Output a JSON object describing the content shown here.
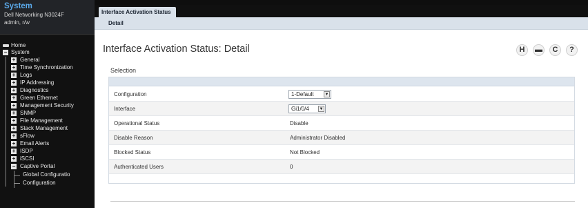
{
  "system_panel": {
    "title": "System",
    "device": "Dell Networking N3024F",
    "user": "admin, r/w"
  },
  "nav": {
    "home": "Home",
    "system": "System",
    "items": [
      "General",
      "Time Synchronization",
      "Logs",
      "IP Addressing",
      "Diagnostics",
      "Green Ethernet",
      "Management Security",
      "SNMP",
      "File Management",
      "Stack Management",
      "sFlow",
      "Email Alerts",
      "ISDP",
      "iSCSI",
      "Captive Portal"
    ],
    "captive_children": [
      "Global Configuratio",
      "Configuration"
    ]
  },
  "tabs": {
    "active": "Interface Activation Status",
    "sub": "Detail"
  },
  "page": {
    "title": "Interface Activation Status: Detail",
    "section": "Selection"
  },
  "toolbar": {
    "save": "H",
    "print": "▬",
    "refresh": "C",
    "help": "?"
  },
  "fields": [
    {
      "label": "Configuration",
      "value": "1-Default",
      "type": "select"
    },
    {
      "label": "Interface",
      "value": "Gi1/0/4",
      "type": "select"
    },
    {
      "label": "Operational Status",
      "value": "Disable",
      "type": "text"
    },
    {
      "label": "Disable Reason",
      "value": "Administrator Disabled",
      "type": "text"
    },
    {
      "label": "Blocked Status",
      "value": "Not Blocked",
      "type": "text"
    },
    {
      "label": "Authenticated Users",
      "value": "0",
      "type": "text"
    }
  ]
}
